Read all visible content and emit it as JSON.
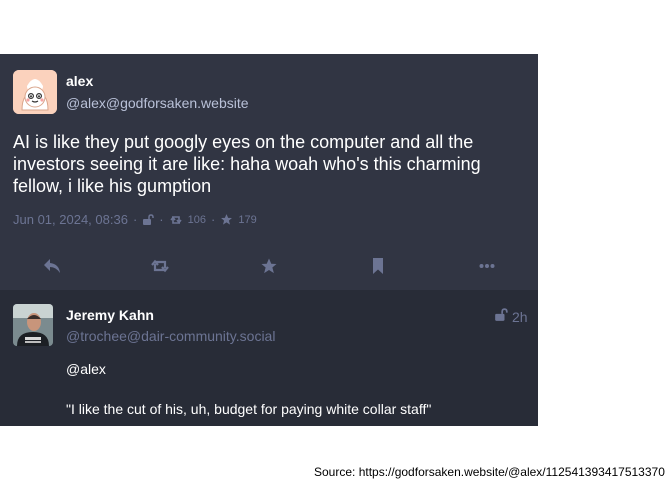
{
  "post": {
    "author_name": "alex",
    "author_handle": "@alex@godforsaken.website",
    "content": "AI is like they put googly eyes on the computer and all the investors seeing it are like: haha woah who's this charming fellow, i like his gumption",
    "date": "Jun 01, 2024, 08:36",
    "boosts": "106",
    "favourites": "179",
    "icons": [
      "unlisted-lock-icon",
      "retweet-icon",
      "star-icon"
    ],
    "actions": [
      "reply-icon",
      "boost-icon",
      "favourite-icon",
      "bookmark-icon",
      "more-icon"
    ]
  },
  "reply": {
    "author_name": "Jeremy Kahn",
    "author_handle": "@trochee@dair-community.social",
    "time": "2h",
    "paragraph_1": "@alex",
    "paragraph_2": "\"I like the cut of his, uh, budget for paying white collar staff\""
  },
  "source": "Source: https://godforsaken.website/@alex/112541393417513370",
  "colors": {
    "card_bg": "#313543",
    "reply_bg": "#282c37",
    "muted": "#6c7493",
    "handle": "#b9c1d8",
    "text": "#ffffff"
  }
}
